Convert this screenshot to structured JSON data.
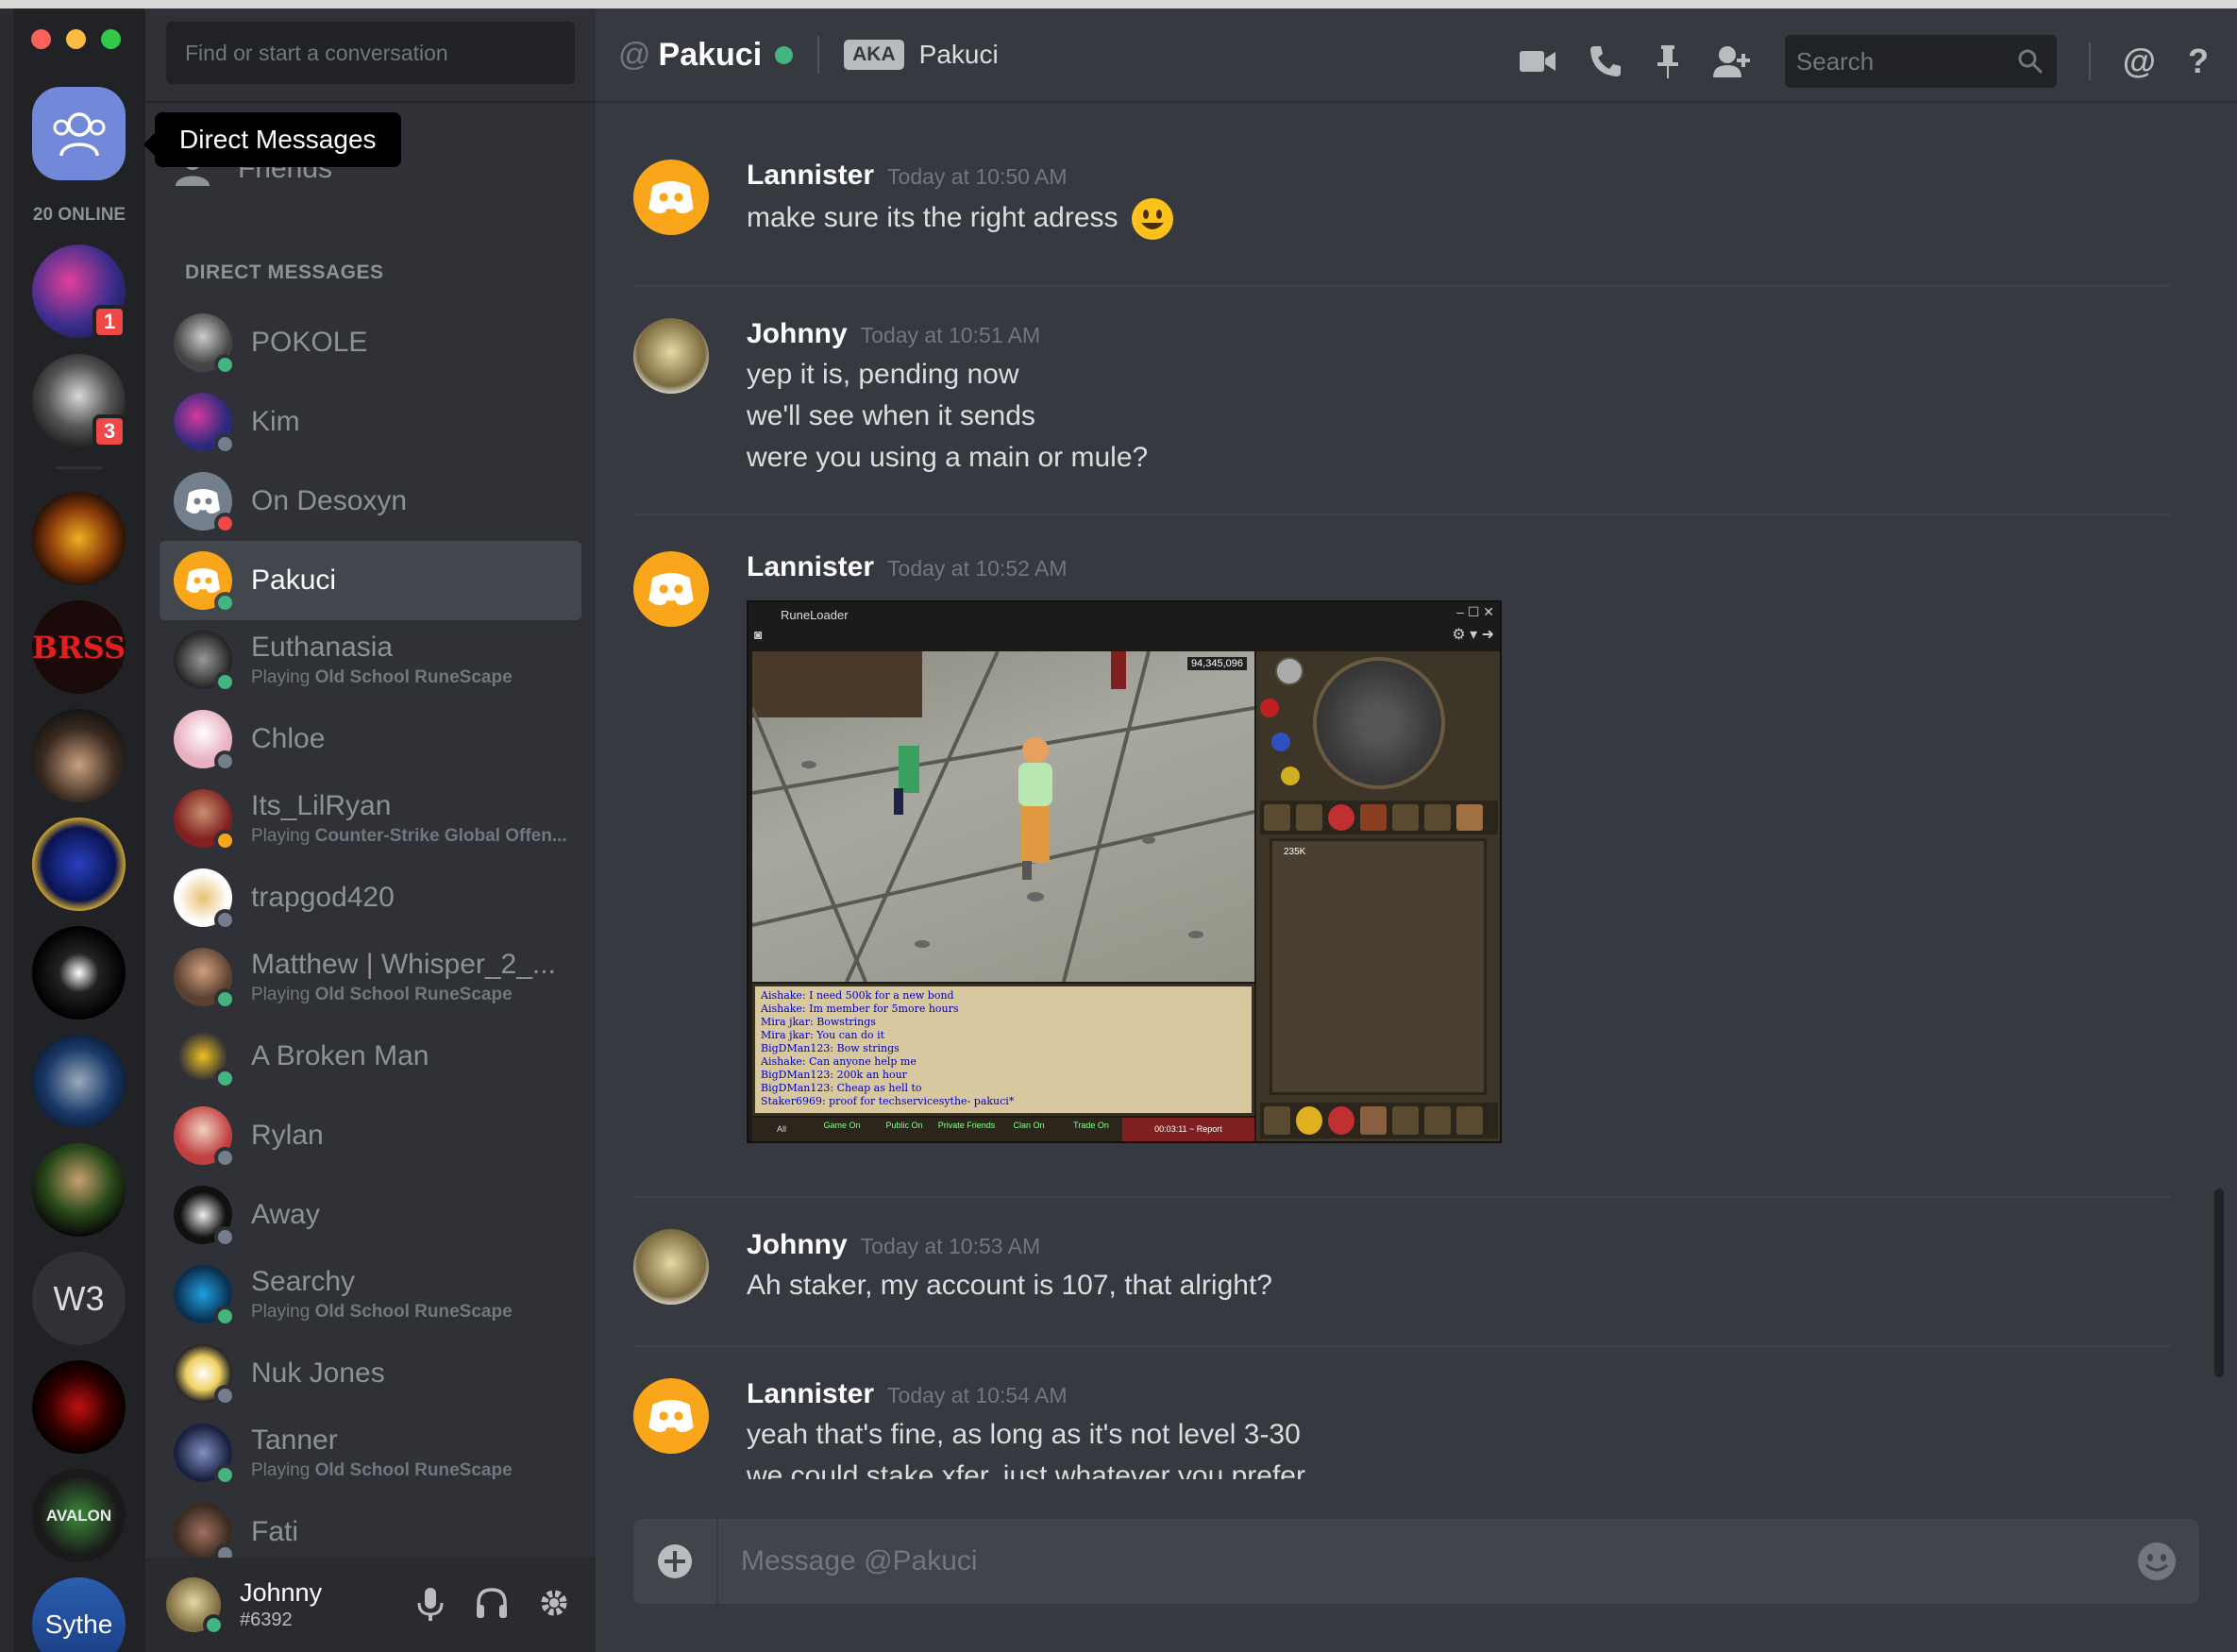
{
  "colors": {
    "blurple": "#7289da",
    "online": "#43b581",
    "idle": "#faa61a",
    "dnd": "#f04747",
    "offline": "#747f8d",
    "discord_orange": "#faa61a"
  },
  "rail": {
    "online_count": "20 ONLINE",
    "tooltip": "Direct Messages",
    "servers": [
      {
        "name": "server-1",
        "badge": "1"
      },
      {
        "name": "server-2",
        "badge": "3"
      },
      {
        "name": "server-3"
      },
      {
        "name": "server-brss",
        "label": "BRSS"
      },
      {
        "name": "server-5"
      },
      {
        "name": "server-6"
      },
      {
        "name": "server-7"
      },
      {
        "name": "server-8"
      },
      {
        "name": "server-9"
      },
      {
        "name": "server-w3",
        "label": "W3"
      },
      {
        "name": "server-11"
      },
      {
        "name": "server-avalon",
        "label": "AVALON"
      },
      {
        "name": "server-sythe",
        "label": "Sythe"
      }
    ]
  },
  "sidebar": {
    "search_placeholder": "Find or start a conversation",
    "friends_label": "Friends",
    "dm_header": "DIRECT MESSAGES",
    "dms": [
      {
        "name": "POKOLE",
        "status": "online"
      },
      {
        "name": "Kim",
        "status": "offline"
      },
      {
        "name": "On Desoxyn",
        "status": "dnd"
      },
      {
        "name": "Pakuci",
        "status": "online",
        "active": true
      },
      {
        "name": "Euthanasia",
        "status": "online",
        "activity_prefix": "Playing ",
        "activity": "Old School RuneScape"
      },
      {
        "name": "Chloe",
        "status": "offline"
      },
      {
        "name": "Its_LilRyan",
        "status": "idle",
        "activity_prefix": "Playing ",
        "activity": "Counter-Strike Global Offen..."
      },
      {
        "name": "trapgod420",
        "status": "offline"
      },
      {
        "name": "Matthew | Whisper_2_...",
        "status": "online",
        "activity_prefix": "Playing ",
        "activity": "Old School RuneScape"
      },
      {
        "name": "A Broken Man",
        "status": "online"
      },
      {
        "name": "Rylan",
        "status": "offline"
      },
      {
        "name": "Away",
        "status": "offline"
      },
      {
        "name": "Searchy",
        "status": "online",
        "activity_prefix": "Playing ",
        "activity": "Old School RuneScape"
      },
      {
        "name": "Nuk Jones",
        "status": "offline"
      },
      {
        "name": "Tanner",
        "status": "online",
        "activity_prefix": "Playing ",
        "activity": "Old School RuneScape"
      },
      {
        "name": "Fati",
        "status": "offline"
      }
    ],
    "user": {
      "name": "Johnny",
      "tag": "#6392"
    }
  },
  "header": {
    "at": "@",
    "channel_name": "Pakuci",
    "aka_badge": "AKA",
    "aka_name": "Pakuci",
    "search_placeholder": "Search",
    "mention_icon": "@",
    "help_icon": "?"
  },
  "messages": [
    {
      "author": "Lannister",
      "time": "Today at 10:50 AM",
      "lines": [
        "make sure its the right adress"
      ],
      "emoji": "smiley"
    },
    {
      "author": "Johnny",
      "time": "Today at 10:51 AM",
      "lines": [
        "yep it is, pending now",
        "we'll see when it sends",
        "were you using a main or mule?"
      ]
    },
    {
      "author": "Lannister",
      "time": "Today at 10:52 AM",
      "lines": [],
      "attachment": {
        "title": "RuneLoader",
        "gold": "94,345,096",
        "chat": [
          "Aishake: I need 500k for a new bond",
          "Aishake: Im member for 5more hours",
          "Mira jkar: Bowstrings",
          "Mira jkar: You can do it",
          "BigDMan123: Bow strings",
          "Aishake: Can anyone help me",
          "BigDMan123: 200k an hour",
          "BigDMan123: Cheap as hell to",
          "Staker6969: proof for techservicesythe- pakuci*"
        ],
        "tabs": [
          "All",
          "Game On",
          "Public On",
          "Private Friends",
          "Clan On",
          "Trade On"
        ],
        "report": "00:03:11 ~ Report",
        "stack": "235K"
      }
    },
    {
      "author": "Johnny",
      "time": "Today at 10:53 AM",
      "lines": [
        "Ah staker, my account is 107, that alright?"
      ]
    },
    {
      "author": "Lannister",
      "time": "Today at 10:54 AM",
      "lines": [
        "yeah that's fine, as long as it's not level 3-30",
        "we could stake xfer, just whatever you prefer"
      ]
    }
  ],
  "composer": {
    "placeholder": "Message @Pakuci"
  }
}
